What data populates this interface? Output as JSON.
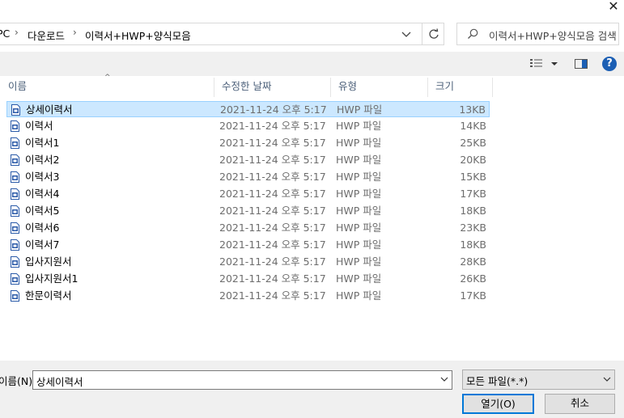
{
  "address": {
    "crumbs": [
      "PC",
      "다운로드",
      "이력서+HWP+양식모음"
    ],
    "search_placeholder": "이력서+HWP+양식모음 검색"
  },
  "columns": {
    "name": "이름",
    "date": "수정한 날짜",
    "type": "유형",
    "size": "크기"
  },
  "files": [
    {
      "name": "상세이력서",
      "date": "2021-11-24 오후 5:17",
      "type": "HWP 파일",
      "size": "13KB",
      "selected": true
    },
    {
      "name": "이력서",
      "date": "2021-11-24 오후 5:17",
      "type": "HWP 파일",
      "size": "14KB"
    },
    {
      "name": "이력서1",
      "date": "2021-11-24 오후 5:17",
      "type": "HWP 파일",
      "size": "25KB"
    },
    {
      "name": "이력서2",
      "date": "2021-11-24 오후 5:17",
      "type": "HWP 파일",
      "size": "20KB"
    },
    {
      "name": "이력서3",
      "date": "2021-11-24 오후 5:17",
      "type": "HWP 파일",
      "size": "15KB"
    },
    {
      "name": "이력서4",
      "date": "2021-11-24 오후 5:17",
      "type": "HWP 파일",
      "size": "17KB"
    },
    {
      "name": "이력서5",
      "date": "2021-11-24 오후 5:17",
      "type": "HWP 파일",
      "size": "18KB"
    },
    {
      "name": "이력서6",
      "date": "2021-11-24 오후 5:17",
      "type": "HWP 파일",
      "size": "23KB"
    },
    {
      "name": "이력서7",
      "date": "2021-11-24 오후 5:17",
      "type": "HWP 파일",
      "size": "18KB"
    },
    {
      "name": "입사지원서",
      "date": "2021-11-24 오후 5:17",
      "type": "HWP 파일",
      "size": "28KB"
    },
    {
      "name": "입사지원서1",
      "date": "2021-11-24 오후 5:17",
      "type": "HWP 파일",
      "size": "26KB"
    },
    {
      "name": "한문이력서",
      "date": "2021-11-24 오후 5:17",
      "type": "HWP 파일",
      "size": "17KB"
    }
  ],
  "footer": {
    "filename_label": "이름(N):",
    "filename_value": "상세이력서",
    "filetype_value": "모든 파일(*.*)",
    "open_label": "열기(O)",
    "cancel_label": "취소"
  },
  "icons": {
    "close": "close-icon",
    "chevron": "chevron-down-icon",
    "refresh": "refresh-icon",
    "search": "search-icon",
    "help": "help-icon",
    "file": "hwp-file-icon"
  },
  "colors": {
    "selection": "#cce8ff",
    "selection_border": "#99d1ff",
    "accent": "#0078d7"
  },
  "help_glyph": "?",
  "close_glyph": "✕"
}
